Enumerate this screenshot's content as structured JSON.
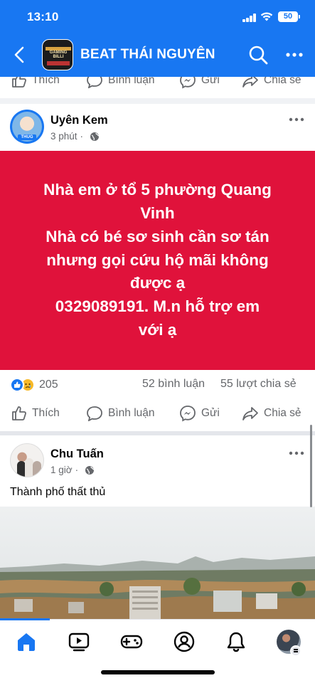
{
  "status_bar": {
    "time": "13:10",
    "battery": "50"
  },
  "header": {
    "title": "BEAT THÁI NGUYÊN",
    "page_logo_text": "GAMING BILLI"
  },
  "top_actions": {
    "like": "Thích",
    "comment": "Bình luận",
    "send": "Gửi",
    "share": "Chia sẻ"
  },
  "post1": {
    "author": "Uyên Kem",
    "time": "3 phút",
    "avatar_tag": "THUG",
    "text_lines": [
      "Nhà em ở tổ 5 phường Quang",
      "Vinh",
      "Nhà có bé sơ sinh cần sơ tán",
      "nhưng gọi cứu hộ mãi không",
      "được ạ",
      "0329089191. M.n hỗ trợ em",
      "với ạ"
    ],
    "reaction_count": "205",
    "comment_count": "52 bình luận",
    "share_count": "55 lượt chia sẻ",
    "actions": {
      "like": "Thích",
      "comment": "Bình luận",
      "send": "Gửi",
      "share": "Chia sẻ"
    }
  },
  "post2": {
    "author": "Chu Tuấn",
    "time": "1 giờ",
    "text": "Thành phố thất thủ"
  },
  "bottom_nav": [
    "home",
    "video",
    "gaming",
    "profile",
    "notifications",
    "menu"
  ],
  "colors": {
    "brand": "#1877f2",
    "card_red": "#e0123b",
    "muted": "#65676b"
  }
}
